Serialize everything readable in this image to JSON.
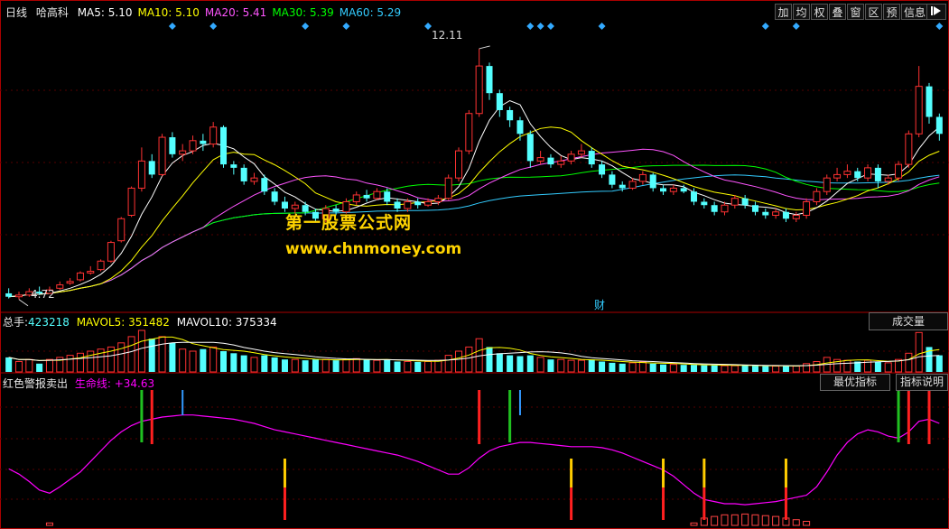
{
  "header": {
    "period": "日线",
    "stock": "哈高科",
    "ma": [
      {
        "label": "MA5: 5.10",
        "color": "#ffffff"
      },
      {
        "label": "MA10: 5.10",
        "color": "#ffff00"
      },
      {
        "label": "MA20: 5.41",
        "color": "#ff55ff"
      },
      {
        "label": "MA30: 5.39",
        "color": "#00ff00"
      },
      {
        "label": "MA60: 5.29",
        "color": "#33ccff"
      }
    ]
  },
  "toolbar": [
    "加",
    "均",
    "权",
    "叠",
    "窗",
    "区",
    "预",
    "信息"
  ],
  "toolbar_icon": "right-triangle-icon",
  "price_labels": {
    "high": "12.11",
    "low": "4.72",
    "cai": "财"
  },
  "watermark": {
    "line1": "第一股票公式网",
    "line2": "www.chnmoney.com"
  },
  "volume_panel": {
    "total_label": "总手:",
    "total_value": "423218",
    "mavol5": "MAVOL5: 351482",
    "mavol10": "MAVOL10: 375334",
    "button": "成交量"
  },
  "indicator_panel": {
    "name": "红色警报卖出",
    "line_label": "生命线: +34.63",
    "btn_best": "最优指标",
    "btn_help": "指标说明"
  },
  "colors": {
    "up": "#ff3232",
    "down": "#54ffff",
    "ma5": "#ffffff",
    "ma10": "#ffff00",
    "ma20": "#ff55ff",
    "ma30": "#00ff00",
    "ma60": "#33ccff",
    "life": "#ff00ff"
  },
  "chart_data": {
    "type": "candlestick",
    "n": 92,
    "price_range": [
      4.5,
      12.8
    ],
    "price_extremes": {
      "high": 12.11,
      "low": 4.72
    },
    "candles": [
      [
        4.9,
        4.8,
        5.05,
        4.75
      ],
      [
        4.8,
        4.85,
        4.95,
        4.72
      ],
      [
        4.85,
        4.95,
        5.05,
        4.8
      ],
      [
        4.95,
        4.9,
        5.1,
        4.85
      ],
      [
        4.9,
        5.0,
        5.1,
        4.88
      ],
      [
        5.05,
        5.15,
        5.25,
        5.0
      ],
      [
        5.2,
        5.25,
        5.35,
        5.15
      ],
      [
        5.3,
        5.5,
        5.55,
        5.25
      ],
      [
        5.5,
        5.55,
        5.7,
        5.45
      ],
      [
        5.6,
        5.85,
        5.9,
        5.55
      ],
      [
        5.85,
        6.4,
        6.45,
        5.8
      ],
      [
        6.45,
        7.1,
        7.15,
        6.4
      ],
      [
        7.2,
        8.0,
        8.05,
        7.15
      ],
      [
        8.0,
        8.8,
        9.2,
        7.9
      ],
      [
        8.8,
        8.4,
        9.0,
        8.3
      ],
      [
        8.4,
        9.5,
        9.6,
        8.35
      ],
      [
        9.5,
        9.0,
        9.65,
        8.9
      ],
      [
        9.0,
        9.1,
        9.3,
        8.8
      ],
      [
        9.1,
        9.4,
        9.55,
        9.0
      ],
      [
        9.4,
        9.3,
        9.6,
        9.1
      ],
      [
        9.3,
        9.8,
        9.95,
        9.2
      ],
      [
        9.8,
        8.7,
        9.85,
        8.6
      ],
      [
        8.7,
        8.6,
        8.8,
        8.4
      ],
      [
        8.6,
        8.2,
        8.7,
        8.1
      ],
      [
        8.2,
        8.3,
        8.45,
        8.1
      ],
      [
        8.3,
        7.9,
        8.4,
        7.8
      ],
      [
        7.9,
        7.6,
        8.0,
        7.5
      ],
      [
        7.6,
        7.4,
        7.75,
        7.3
      ],
      [
        7.4,
        7.5,
        7.6,
        7.25
      ],
      [
        7.5,
        7.3,
        7.6,
        7.2
      ],
      [
        7.3,
        7.1,
        7.4,
        7.0
      ],
      [
        7.1,
        7.4,
        7.5,
        7.0
      ],
      [
        7.4,
        7.3,
        7.5,
        7.2
      ],
      [
        7.3,
        7.6,
        7.7,
        7.25
      ],
      [
        7.6,
        7.8,
        7.9,
        7.5
      ],
      [
        7.8,
        7.7,
        7.95,
        7.6
      ],
      [
        7.7,
        7.9,
        8.0,
        7.65
      ],
      [
        7.9,
        7.6,
        8.0,
        7.5
      ],
      [
        7.6,
        7.4,
        7.7,
        7.3
      ],
      [
        7.4,
        7.6,
        7.7,
        7.3
      ],
      [
        7.6,
        7.5,
        7.7,
        7.4
      ],
      [
        7.5,
        7.6,
        7.7,
        7.45
      ],
      [
        7.6,
        7.7,
        7.8,
        7.5
      ],
      [
        7.7,
        8.3,
        8.4,
        7.65
      ],
      [
        8.3,
        9.1,
        9.2,
        8.2
      ],
      [
        9.1,
        10.2,
        10.3,
        9.0
      ],
      [
        10.2,
        11.6,
        12.11,
        10.1
      ],
      [
        11.6,
        10.8,
        11.7,
        10.6
      ],
      [
        10.8,
        10.3,
        10.9,
        10.1
      ],
      [
        10.3,
        10.0,
        10.4,
        9.8
      ],
      [
        10.0,
        9.6,
        10.1,
        9.4
      ],
      [
        9.6,
        8.8,
        9.7,
        8.6
      ],
      [
        8.8,
        8.9,
        9.1,
        8.7
      ],
      [
        8.9,
        8.7,
        9.0,
        8.6
      ],
      [
        8.7,
        8.8,
        8.95,
        8.6
      ],
      [
        8.8,
        9.0,
        9.1,
        8.7
      ],
      [
        9.0,
        9.1,
        9.3,
        8.9
      ],
      [
        9.1,
        8.7,
        9.2,
        8.6
      ],
      [
        8.7,
        8.4,
        8.8,
        8.3
      ],
      [
        8.4,
        8.1,
        8.5,
        8.0
      ],
      [
        8.1,
        8.0,
        8.2,
        7.9
      ],
      [
        8.0,
        8.2,
        8.3,
        7.95
      ],
      [
        8.2,
        8.4,
        8.5,
        8.1
      ],
      [
        8.4,
        8.0,
        8.45,
        7.9
      ],
      [
        8.0,
        7.9,
        8.1,
        7.8
      ],
      [
        7.9,
        8.0,
        8.1,
        7.8
      ],
      [
        8.0,
        7.9,
        8.1,
        7.85
      ],
      [
        7.9,
        7.6,
        8.0,
        7.5
      ],
      [
        7.6,
        7.5,
        7.7,
        7.4
      ],
      [
        7.5,
        7.3,
        7.6,
        7.2
      ],
      [
        7.3,
        7.5,
        7.6,
        7.2
      ],
      [
        7.5,
        7.7,
        7.8,
        7.4
      ],
      [
        7.7,
        7.5,
        7.8,
        7.4
      ],
      [
        7.5,
        7.3,
        7.6,
        7.2
      ],
      [
        7.3,
        7.2,
        7.4,
        7.1
      ],
      [
        7.2,
        7.3,
        7.4,
        7.1
      ],
      [
        7.3,
        7.1,
        7.4,
        7.0
      ],
      [
        7.1,
        7.2,
        7.3,
        7.0
      ],
      [
        7.2,
        7.6,
        7.7,
        7.1
      ],
      [
        7.6,
        7.9,
        8.0,
        7.5
      ],
      [
        7.9,
        8.3,
        8.4,
        7.8
      ],
      [
        8.3,
        8.4,
        8.6,
        8.2
      ],
      [
        8.4,
        8.5,
        8.7,
        8.3
      ],
      [
        8.5,
        8.3,
        8.6,
        8.2
      ],
      [
        8.3,
        8.6,
        8.7,
        8.2
      ],
      [
        8.6,
        8.2,
        8.7,
        8.0
      ],
      [
        8.2,
        8.3,
        8.4,
        8.1
      ],
      [
        8.3,
        8.7,
        8.8,
        8.2
      ],
      [
        8.7,
        9.6,
        9.7,
        8.6
      ],
      [
        9.6,
        11.0,
        11.6,
        9.5
      ],
      [
        11.0,
        10.1,
        11.1,
        9.9
      ],
      [
        10.1,
        9.6,
        10.2,
        9.4
      ]
    ],
    "volume": [
      0.35,
      0.25,
      0.3,
      0.2,
      0.3,
      0.35,
      0.4,
      0.45,
      0.5,
      0.55,
      0.6,
      0.7,
      0.85,
      1.0,
      0.8,
      0.85,
      0.7,
      0.55,
      0.5,
      0.55,
      0.6,
      0.5,
      0.45,
      0.4,
      0.35,
      0.4,
      0.35,
      0.3,
      0.3,
      0.28,
      0.3,
      0.3,
      0.28,
      0.3,
      0.32,
      0.3,
      0.28,
      0.3,
      0.25,
      0.25,
      0.24,
      0.25,
      0.28,
      0.4,
      0.5,
      0.6,
      0.8,
      0.6,
      0.45,
      0.4,
      0.38,
      0.4,
      0.35,
      0.3,
      0.3,
      0.28,
      0.28,
      0.3,
      0.25,
      0.22,
      0.2,
      0.22,
      0.24,
      0.2,
      0.18,
      0.18,
      0.17,
      0.17,
      0.16,
      0.16,
      0.15,
      0.15,
      0.16,
      0.15,
      0.14,
      0.14,
      0.14,
      0.14,
      0.2,
      0.25,
      0.35,
      0.3,
      0.28,
      0.25,
      0.28,
      0.25,
      0.22,
      0.3,
      0.45,
      0.95,
      0.6,
      0.4
    ],
    "life_line": [
      45,
      40,
      33,
      25,
      22,
      28,
      35,
      42,
      52,
      62,
      72,
      80,
      86,
      90,
      92,
      94,
      95,
      96,
      96,
      95,
      94,
      93,
      92,
      90,
      88,
      85,
      82,
      80,
      78,
      76,
      74,
      72,
      70,
      68,
      66,
      64,
      62,
      60,
      58,
      55,
      52,
      48,
      44,
      40,
      40,
      46,
      55,
      62,
      66,
      68,
      70,
      70,
      69,
      68,
      67,
      66,
      66,
      66,
      65,
      63,
      60,
      56,
      52,
      48,
      44,
      38,
      30,
      22,
      16,
      14,
      12,
      12,
      11,
      12,
      13,
      14,
      16,
      18,
      20,
      28,
      42,
      58,
      70,
      78,
      82,
      80,
      76,
      74,
      80,
      90,
      92,
      88
    ],
    "signals": [
      {
        "i": 13,
        "type": "green-up"
      },
      {
        "i": 14,
        "type": "red-up"
      },
      {
        "i": 17,
        "type": "blue-up"
      },
      {
        "i": 46,
        "type": "red-up"
      },
      {
        "i": 49,
        "type": "green-up"
      },
      {
        "i": 50,
        "type": "blue-up"
      },
      {
        "i": 27,
        "type": "yellow-down"
      },
      {
        "i": 55,
        "type": "yellow-down"
      },
      {
        "i": 64,
        "type": "yellow-down"
      },
      {
        "i": 68,
        "type": "yellow-down"
      },
      {
        "i": 76,
        "type": "yellow-down"
      },
      {
        "i": 88,
        "type": "red-up"
      },
      {
        "i": 90,
        "type": "red-up"
      },
      {
        "i": 87,
        "type": "green-up"
      }
    ]
  }
}
